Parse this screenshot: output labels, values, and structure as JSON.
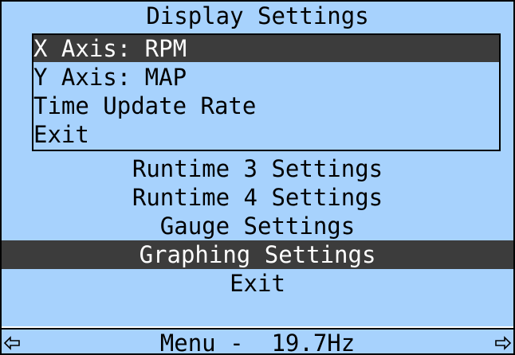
{
  "colors": {
    "background": "#a7d2fd",
    "highlight": "#3c3c3c",
    "text": "#000000",
    "highlight_text": "#ffffff"
  },
  "header": {
    "title": "Display Settings"
  },
  "submenu": {
    "items": [
      {
        "label": "X Axis: RPM",
        "selected": true
      },
      {
        "label": "Y Axis: MAP",
        "selected": false
      },
      {
        "label": "Time Update Rate",
        "selected": false
      },
      {
        "label": "Exit",
        "selected": false
      }
    ]
  },
  "menu": {
    "items": [
      {
        "label": "Runtime 3 Settings",
        "selected": false
      },
      {
        "label": "Runtime 4 Settings",
        "selected": false
      },
      {
        "label": "Gauge Settings",
        "selected": false
      },
      {
        "label": "Graphing Settings",
        "selected": true
      },
      {
        "label": "Exit",
        "selected": false
      }
    ]
  },
  "status_bar": {
    "text": "Menu -  19.7Hz",
    "left_icon": "arrow-left-icon",
    "right_icon": "arrow-right-icon"
  }
}
